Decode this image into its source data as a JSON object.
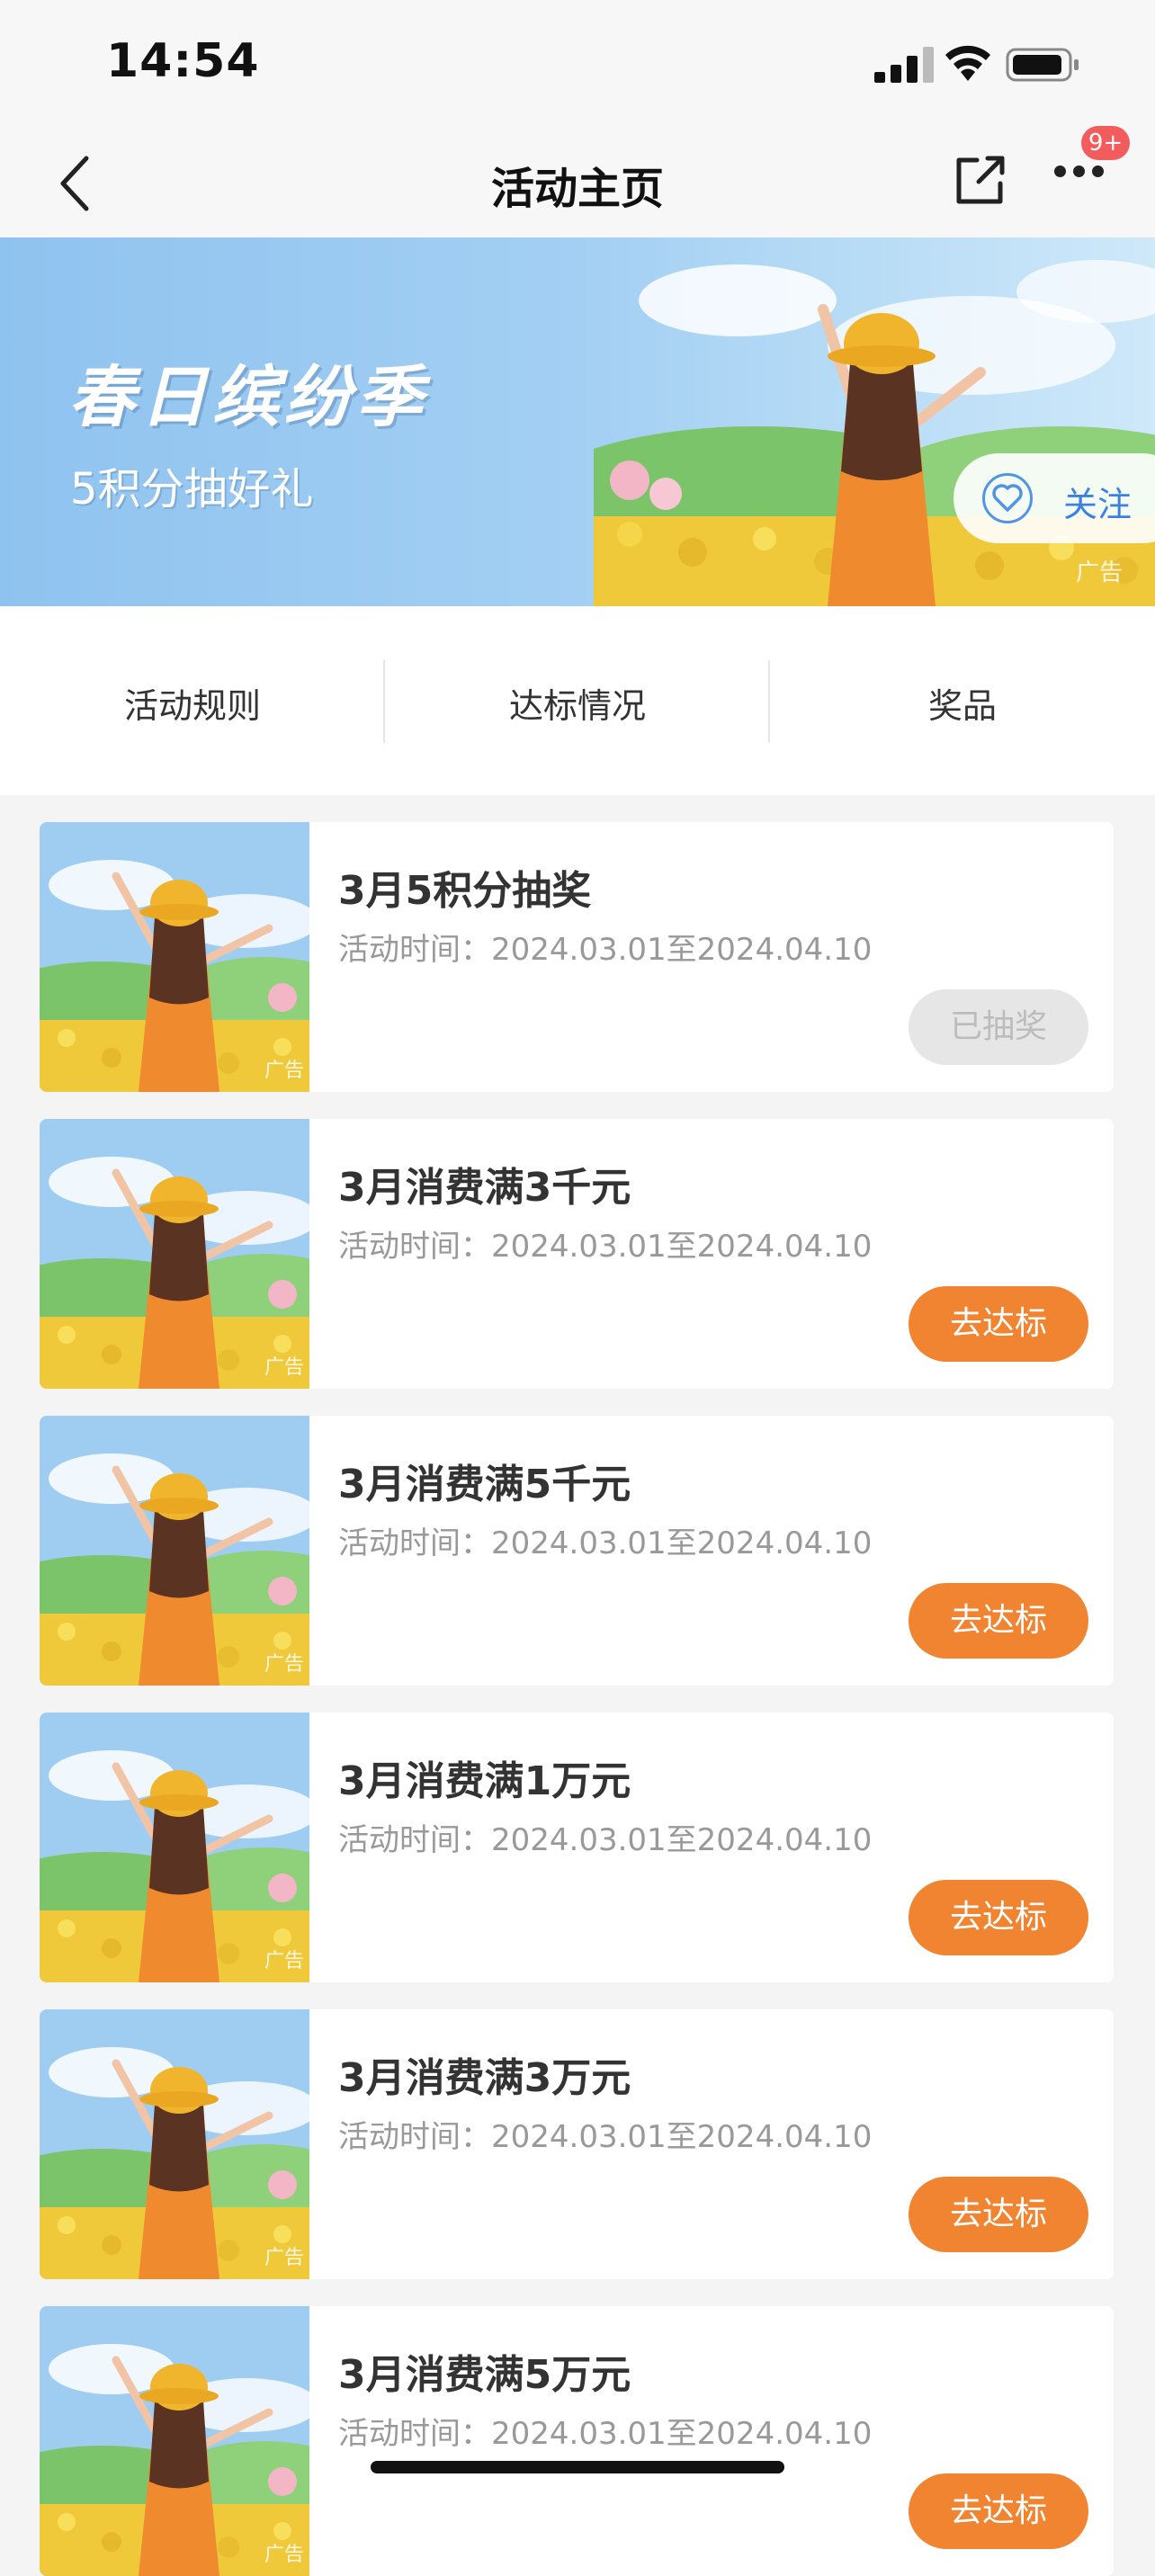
{
  "status_bar": {
    "time": "14:54"
  },
  "nav": {
    "title": "活动主页",
    "badge": "9+"
  },
  "banner": {
    "title": "春日缤纷季",
    "subtitle": "5积分抽好礼",
    "follow_label": "关注",
    "ad_label": "广告"
  },
  "tabs": [
    "活动规则",
    "达标情况",
    "奖品"
  ],
  "activities": [
    {
      "title": "3月5积分抽奖",
      "time": "活动时间：2024.03.01至2024.04.10",
      "button": "已抽奖",
      "button_state": "disabled",
      "ad_label": "广告"
    },
    {
      "title": "3月消费满3千元",
      "time": "活动时间：2024.03.01至2024.04.10",
      "button": "去达标",
      "button_state": "active",
      "ad_label": "广告"
    },
    {
      "title": "3月消费满5千元",
      "time": "活动时间：2024.03.01至2024.04.10",
      "button": "去达标",
      "button_state": "active",
      "ad_label": "广告"
    },
    {
      "title": "3月消费满1万元",
      "time": "活动时间：2024.03.01至2024.04.10",
      "button": "去达标",
      "button_state": "active",
      "ad_label": "广告"
    },
    {
      "title": "3月消费满3万元",
      "time": "活动时间：2024.03.01至2024.04.10",
      "button": "去达标",
      "button_state": "active",
      "ad_label": "广告"
    },
    {
      "title": "3月消费满5万元",
      "time": "活动时间：2024.03.01至2024.04.10",
      "button": "去达标",
      "button_state": "active",
      "ad_label": "广告"
    }
  ],
  "colors": {
    "accent": "#f08431",
    "disabled": "#e6e6e6",
    "link": "#3b82e0",
    "badge": "#f25c5c"
  }
}
